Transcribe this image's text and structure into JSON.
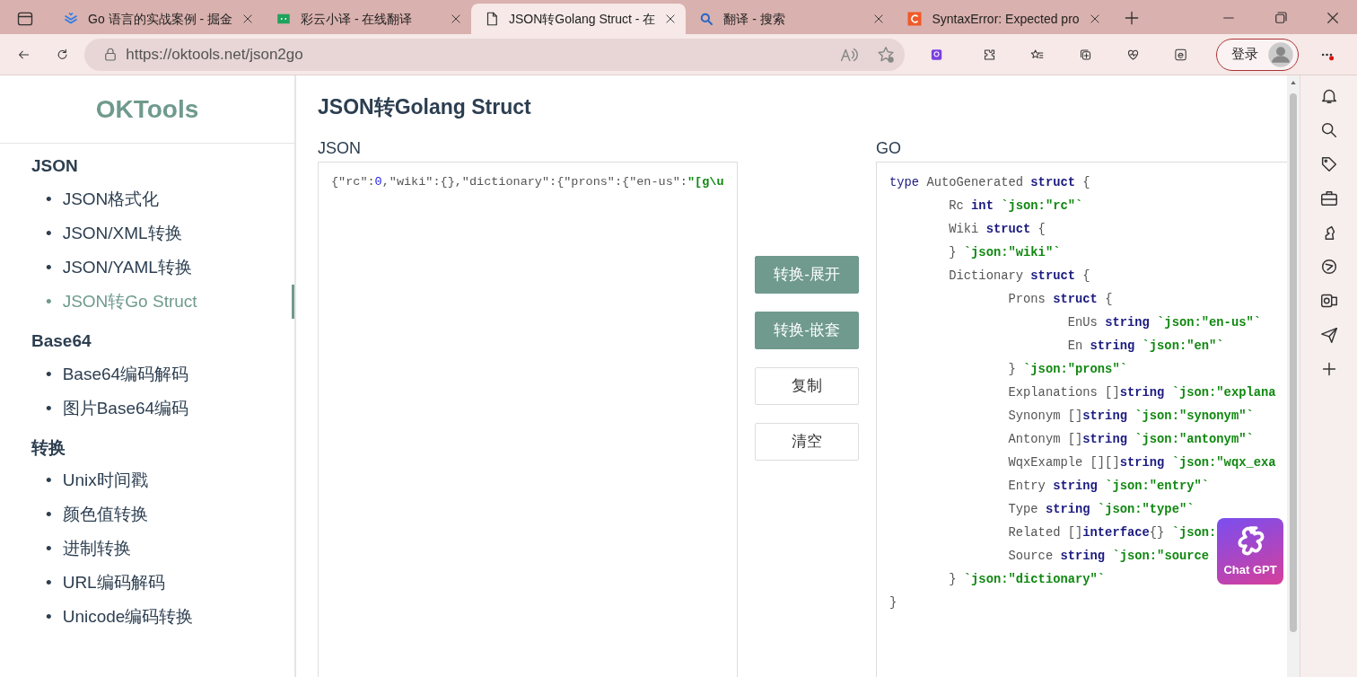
{
  "browser": {
    "tabs": [
      {
        "title": "Go 语言的实战案例 - 掘金",
        "kind": "juejin",
        "selected": false
      },
      {
        "title": "彩云小译 - 在线翻译",
        "kind": "caiyun",
        "selected": false
      },
      {
        "title": "JSON转Golang Struct - 在",
        "kind": "page",
        "selected": true
      },
      {
        "title": "翻译 - 搜索",
        "kind": "search",
        "selected": false
      },
      {
        "title": "SyntaxError: Expected pro",
        "kind": "letter",
        "selected": false
      }
    ],
    "url": "https://oktools.net/json2go",
    "login": "登录"
  },
  "site": {
    "logo": "OKTools",
    "nav": [
      {
        "heading": "JSON",
        "items": [
          {
            "marker": "•",
            "label": "JSON格式化",
            "selected": false
          },
          {
            "marker": "•",
            "label": "JSON/XML转换",
            "selected": false
          },
          {
            "marker": "•",
            "label": "JSON/YAML转换",
            "selected": false
          },
          {
            "marker": "•",
            "label": "JSON转Go Struct",
            "selected": true
          }
        ]
      },
      {
        "heading": "Base64",
        "items": [
          {
            "marker": "•",
            "label": "Base64编码解码",
            "selected": false
          },
          {
            "marker": "•",
            "label": "图片Base64编码",
            "selected": false
          }
        ]
      },
      {
        "heading": "转换",
        "items": [
          {
            "marker": "•",
            "label": "Unix时间戳",
            "selected": false
          },
          {
            "marker": "•",
            "label": "颜色值转换",
            "selected": false
          },
          {
            "marker": "•",
            "label": "进制转换",
            "selected": false
          },
          {
            "marker": "•",
            "label": "URL编码解码",
            "selected": false
          },
          {
            "marker": "•",
            "label": "Unicode编码转换",
            "selected": false
          }
        ]
      }
    ]
  },
  "page": {
    "title": "JSON转Golang Struct",
    "input": {
      "label": "JSON",
      "tokens": [
        {
          "kind": "plain",
          "s": "{\"rc\":"
        },
        {
          "kind": "num",
          "s": "0"
        },
        {
          "kind": "plain",
          "s": ",\"wiki\":{},\"dictionary\":{\"prons\":{\"en-us\":"
        },
        {
          "kind": "tag",
          "s": "\"[g\\u"
        }
      ]
    },
    "buttons": [
      {
        "label": "转换-展开",
        "kind": "filled"
      },
      {
        "label": "转换-嵌套",
        "kind": "filled"
      },
      {
        "label": "复制",
        "kind": "outline"
      },
      {
        "label": "清空",
        "kind": "outline"
      }
    ],
    "output": {
      "label": "GO",
      "lines": [
        [
          {
            "kind": "kw",
            "s": "type"
          },
          {
            "kind": "plain",
            "s": " AutoGenerated "
          },
          {
            "kind": "kwb",
            "s": "struct"
          },
          {
            "kind": "plain",
            "s": " {"
          }
        ],
        [
          {
            "kind": "plain",
            "s": "\tRc "
          },
          {
            "kind": "kwb",
            "s": "int"
          },
          {
            "kind": "tag",
            "s": " `json:\"rc\"`"
          }
        ],
        [
          {
            "kind": "plain",
            "s": "\tWiki "
          },
          {
            "kind": "kwb",
            "s": "struct"
          },
          {
            "kind": "plain",
            "s": " {"
          }
        ],
        [
          {
            "kind": "plain",
            "s": "\t}"
          },
          {
            "kind": "tag",
            "s": " `json:\"wiki\"`"
          }
        ],
        [
          {
            "kind": "plain",
            "s": "\tDictionary "
          },
          {
            "kind": "kwb",
            "s": "struct"
          },
          {
            "kind": "plain",
            "s": " {"
          }
        ],
        [
          {
            "kind": "plain",
            "s": "\t\tProns "
          },
          {
            "kind": "kwb",
            "s": "struct"
          },
          {
            "kind": "plain",
            "s": " {"
          }
        ],
        [
          {
            "kind": "plain",
            "s": "\t\t\tEnUs "
          },
          {
            "kind": "kwb",
            "s": "string"
          },
          {
            "kind": "tag",
            "s": " `json:\"en-us\"`"
          }
        ],
        [
          {
            "kind": "plain",
            "s": "\t\t\tEn "
          },
          {
            "kind": "kwb",
            "s": "string"
          },
          {
            "kind": "tag",
            "s": " `json:\"en\"`"
          }
        ],
        [
          {
            "kind": "plain",
            "s": "\t\t}"
          },
          {
            "kind": "tag",
            "s": " `json:\"prons\"`"
          }
        ],
        [
          {
            "kind": "plain",
            "s": "\t\tExplanations []"
          },
          {
            "kind": "kwb",
            "s": "string"
          },
          {
            "kind": "tag",
            "s": " `json:\"explana"
          }
        ],
        [
          {
            "kind": "plain",
            "s": "\t\tSynonym []"
          },
          {
            "kind": "kwb",
            "s": "string"
          },
          {
            "kind": "tag",
            "s": " `json:\"synonym\"`"
          }
        ],
        [
          {
            "kind": "plain",
            "s": "\t\tAntonym []"
          },
          {
            "kind": "kwb",
            "s": "string"
          },
          {
            "kind": "tag",
            "s": " `json:\"antonym\"`"
          }
        ],
        [
          {
            "kind": "plain",
            "s": "\t\tWqxExample [][]"
          },
          {
            "kind": "kwb",
            "s": "string"
          },
          {
            "kind": "tag",
            "s": " `json:\"wqx_exa"
          }
        ],
        [
          {
            "kind": "plain",
            "s": "\t\tEntry "
          },
          {
            "kind": "kwb",
            "s": "string"
          },
          {
            "kind": "tag",
            "s": " `json:\"entry\"`"
          }
        ],
        [
          {
            "kind": "plain",
            "s": "\t\tType "
          },
          {
            "kind": "kwb",
            "s": "string"
          },
          {
            "kind": "tag",
            "s": " `json:\"type\"`"
          }
        ],
        [
          {
            "kind": "plain",
            "s": "\t\tRelated []"
          },
          {
            "kind": "kwb",
            "s": "interface"
          },
          {
            "kind": "plain",
            "s": "{}"
          },
          {
            "kind": "tag",
            "s": " `json:"
          }
        ],
        [
          {
            "kind": "plain",
            "s": "\t\tSource "
          },
          {
            "kind": "kwb",
            "s": "string"
          },
          {
            "kind": "tag",
            "s": " `json:\"source"
          }
        ],
        [
          {
            "kind": "plain",
            "s": "\t}"
          },
          {
            "kind": "tag",
            "s": " `json:\"dictionary\"`"
          }
        ],
        [
          {
            "kind": "plain",
            "s": "}"
          }
        ]
      ]
    }
  },
  "widget": {
    "label": "Chat GPT"
  }
}
